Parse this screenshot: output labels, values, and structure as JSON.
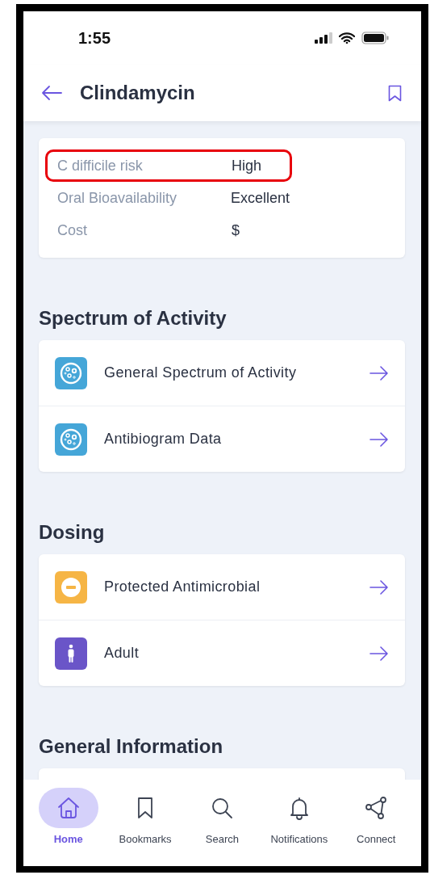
{
  "status_bar": {
    "time": "1:55"
  },
  "header": {
    "title": "Clindamycin"
  },
  "properties": [
    {
      "label": "C difficile risk",
      "value": "High",
      "highlighted": true
    },
    {
      "label": "Oral Bioavailability",
      "value": "Excellent",
      "highlighted": false
    },
    {
      "label": "Cost",
      "value": "$",
      "highlighted": false
    }
  ],
  "sections": [
    {
      "title": "Spectrum of Activity",
      "items": [
        {
          "kind": "dish",
          "label": "General Spectrum of Activity"
        },
        {
          "kind": "dish",
          "label": "Antibiogram Data"
        }
      ]
    },
    {
      "title": "Dosing",
      "items": [
        {
          "kind": "restricted",
          "label": "Protected Antimicrobial"
        },
        {
          "kind": "person",
          "label": "Adult"
        }
      ]
    },
    {
      "title": "General Information"
    }
  ],
  "tabs": [
    {
      "kind": "home",
      "label": "Home",
      "selected": true
    },
    {
      "kind": "bookmark",
      "label": "Bookmarks",
      "selected": false
    },
    {
      "kind": "search",
      "label": "Search",
      "selected": false
    },
    {
      "kind": "bell",
      "label": "Notifications",
      "selected": false
    },
    {
      "kind": "share",
      "label": "Connect",
      "selected": false
    }
  ]
}
